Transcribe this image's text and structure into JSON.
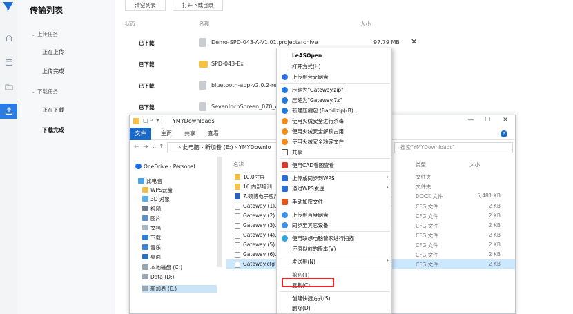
{
  "app": {
    "title": "传输列表",
    "accent": "#2b7be4"
  },
  "sidebar": {
    "groups": [
      {
        "label": "上传任务",
        "items": [
          {
            "label": "正在上传"
          },
          {
            "label": "上传完成"
          }
        ]
      },
      {
        "label": "下载任务",
        "items": [
          {
            "label": "正在下载"
          },
          {
            "label": "下载完成"
          }
        ]
      }
    ]
  },
  "toolbar": {
    "clear_label": "清空列表",
    "open_label": "打开下载目录"
  },
  "table": {
    "headers": {
      "status": "状态",
      "name": "名称",
      "size": "大小"
    },
    "rows": [
      {
        "status": "已下载",
        "name": "Demo-SPD-043-A-V1.01.projectarchive",
        "size": "97.79 MB",
        "icon": "file-icon"
      },
      {
        "status": "已下载",
        "name": "SPD-043-Ex",
        "size": "",
        "icon": "folder-icon"
      },
      {
        "status": "已下载",
        "name": "bluetooth-app-v2.0.2-rele",
        "size": "",
        "icon": "file-icon"
      },
      {
        "status": "已下载",
        "name": "SevenInchScreen_070_Ax",
        "size": "",
        "icon": "file-icon"
      }
    ]
  },
  "explorer": {
    "title": "YMYDownloads",
    "ribbon_tabs": [
      "文件",
      "主页",
      "共享",
      "查看"
    ],
    "address": [
      "此电脑",
      "新加卷 (E:)",
      "YMYDownlo"
    ],
    "search_placeholder": "搜索\"YMYDownloads\"",
    "nav": [
      "OneDrive - Personal",
      "此电脑",
      "WPS云盘",
      "3D 对象",
      "视频",
      "图片",
      "文档",
      "下载",
      "音乐",
      "桌面",
      "本地磁盘 (C:)",
      "Data (D:)",
      "新加卷 (E:)"
    ],
    "columns": {
      "name": "名称",
      "type": "类型",
      "size": "大小"
    },
    "files": [
      {
        "name": "10.0寸屏",
        "type": "文件夹",
        "size": "",
        "icon": "folder-icon"
      },
      {
        "name": "16 内部培训",
        "type": "文件夹",
        "size": "",
        "icon": "folder-icon"
      },
      {
        "name": "7.硕博电子应用",
        "type": "DOCX 文件",
        "size": "5,481 KB",
        "icon": "docx-icon"
      },
      {
        "name": "Gateway (1).c",
        "type": "CFG 文件",
        "size": "2 KB",
        "icon": "file-icon"
      },
      {
        "name": "Gateway (2).c",
        "type": "CFG 文件",
        "size": "2 KB",
        "icon": "file-icon"
      },
      {
        "name": "Gateway (3).c",
        "type": "CFG 文件",
        "size": "2 KB",
        "icon": "file-icon"
      },
      {
        "name": "Gateway (4).c",
        "type": "CFG 文件",
        "size": "2 KB",
        "icon": "file-icon"
      },
      {
        "name": "Gateway (5).c",
        "type": "CFG 文件",
        "size": "2 KB",
        "icon": "file-icon"
      },
      {
        "name": "Gateway (6).c",
        "type": "CFG 文件",
        "size": "2 KB",
        "icon": "file-icon"
      },
      {
        "name": "Gateway.cfg",
        "type": "CFG 文件",
        "size": "2 KB",
        "icon": "file-icon",
        "selected": true
      }
    ]
  },
  "context_menu": {
    "items": [
      {
        "label": "LeASOpen",
        "bold": true
      },
      {
        "label": "打开方式(H)"
      },
      {
        "label": "上传到夸克网盘",
        "icon": "quark-icon"
      },
      {
        "sep": true
      },
      {
        "label": "压缩为\"Gateway.zip\"",
        "icon": "bandizip-icon"
      },
      {
        "label": "压缩为\"Gateway.7z\"",
        "icon": "bandizip-icon"
      },
      {
        "label": "新建压缩包 (Bandizip)(B)...",
        "icon": "bandizip-icon"
      },
      {
        "label": "使用火绒安全进行杀毒",
        "icon": "huorong-icon"
      },
      {
        "label": "使用火绒安全解锁占用",
        "icon": "huorong-icon"
      },
      {
        "label": "使用火绒安全粉碎文件",
        "icon": "huorong-icon"
      },
      {
        "label": "共享",
        "icon": "share-icon"
      },
      {
        "sep": true
      },
      {
        "label": "使用CAD看图查看",
        "icon": "cad-icon"
      },
      {
        "sep": true
      },
      {
        "label": "上传或同步到WPS",
        "icon": "wps-icon",
        "arrow": true
      },
      {
        "label": "通过WPS发送",
        "icon": "wps-icon",
        "arrow": true
      },
      {
        "sep": true
      },
      {
        "label": "手动加密文件",
        "icon": "lock-icon"
      },
      {
        "sep": true
      },
      {
        "label": "上传到百度网盘",
        "icon": "baidu-icon"
      },
      {
        "label": "同步至其它设备",
        "icon": "baidu-icon"
      },
      {
        "sep": true
      },
      {
        "label": "使用联想电脑管家进行扫描",
        "icon": "lenovo-icon"
      },
      {
        "label": "还原以前的版本(V)"
      },
      {
        "sep": true
      },
      {
        "label": "发送到(N)",
        "arrow": true
      },
      {
        "sep": true
      },
      {
        "label": "剪切(T)"
      },
      {
        "label": "复制(C)",
        "highlight": true
      },
      {
        "sep": true
      },
      {
        "label": "创建快捷方式(S)"
      },
      {
        "label": "删除(D)"
      },
      {
        "label": "重命名(M)"
      }
    ]
  }
}
